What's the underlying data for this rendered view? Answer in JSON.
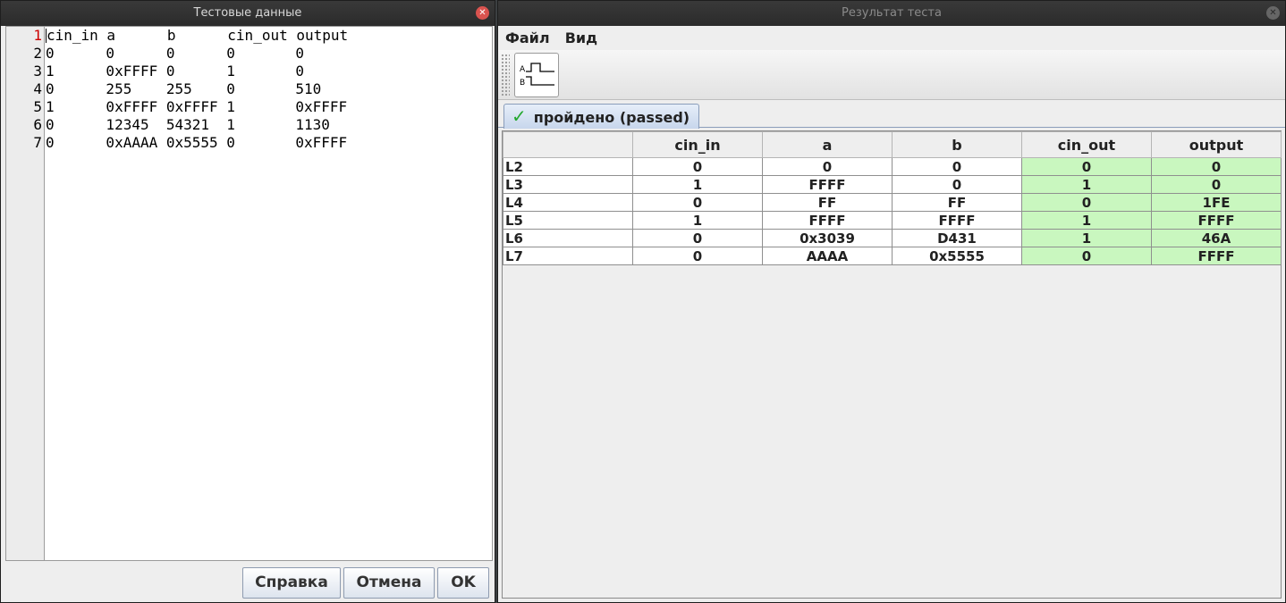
{
  "editor_window": {
    "title": "Тестовые данные",
    "line_numbers": [
      "1",
      "2",
      "3",
      "4",
      "5",
      "6",
      "7"
    ],
    "lines": [
      "cin_in a      b      cin_out output",
      "0      0      0      0       0",
      "1      0xFFFF 0      1       0",
      "0      255    255    0       510",
      "1      0xFFFF 0xFFFF 1       0xFFFF",
      "0      12345  54321  1       1130",
      "0      0xAAAA 0x5555 0       0xFFFF"
    ],
    "buttons": {
      "help": "Справка",
      "cancel": "Отмена",
      "ok": "OK"
    }
  },
  "result_window": {
    "title": "Результат теста",
    "menu": {
      "file": "Файл",
      "view": "Вид"
    },
    "toolbar": {
      "timing_button_icon": "timing-diagram-icon"
    },
    "tab": {
      "label": "пройдено (passed)",
      "status_color": "#23a82e"
    },
    "table": {
      "columns": [
        "",
        "cin_in",
        "a",
        "b",
        "cin_out",
        "output"
      ],
      "rows": [
        {
          "label": "L2",
          "cells": [
            "0",
            "0",
            "0",
            "0",
            "0"
          ]
        },
        {
          "label": "L3",
          "cells": [
            "1",
            "FFFF",
            "0",
            "1",
            "0"
          ]
        },
        {
          "label": "L4",
          "cells": [
            "0",
            "FF",
            "FF",
            "0",
            "1FE"
          ]
        },
        {
          "label": "L5",
          "cells": [
            "1",
            "FFFF",
            "FFFF",
            "1",
            "FFFF"
          ]
        },
        {
          "label": "L6",
          "cells": [
            "0",
            "0x3039",
            "D431",
            "1",
            "46A"
          ]
        },
        {
          "label": "L7",
          "cells": [
            "0",
            "AAAA",
            "0x5555",
            "0",
            "FFFF"
          ]
        }
      ],
      "pass_color": "#c9f7bf"
    }
  }
}
